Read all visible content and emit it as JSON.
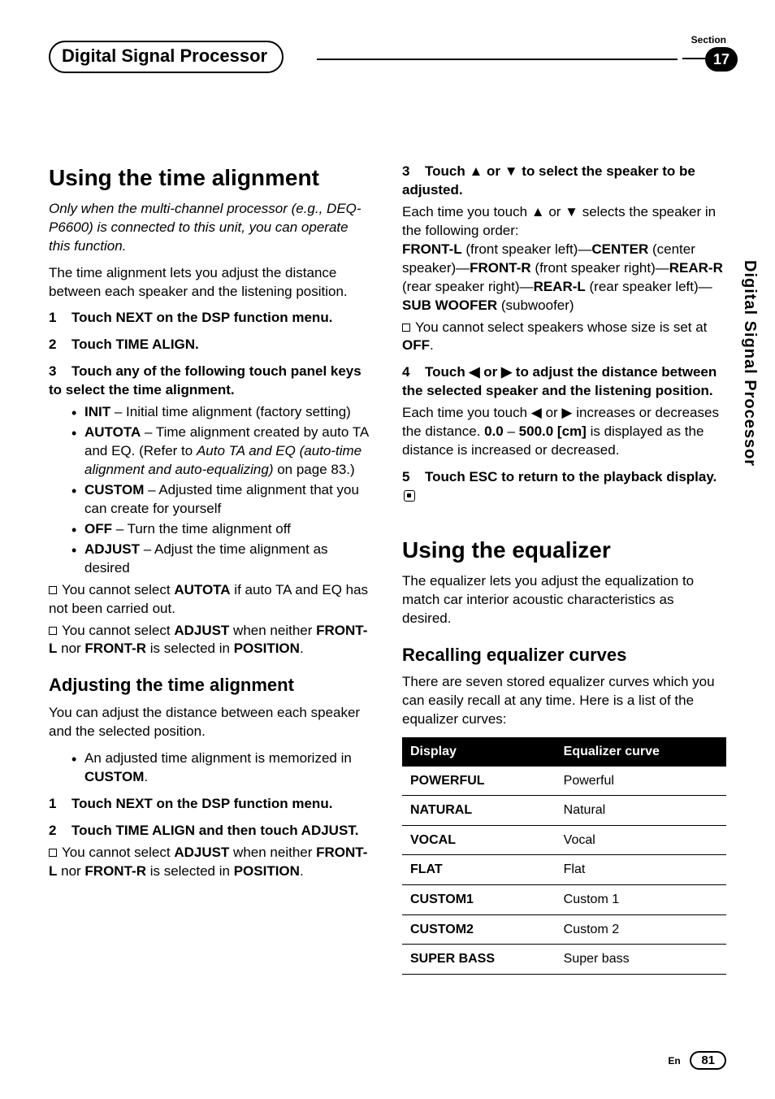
{
  "header": {
    "title": "Digital Signal Processor",
    "section_label": "Section",
    "section_number": "17"
  },
  "side_tab": "Digital Signal Processor",
  "left": {
    "h1": "Using the time alignment",
    "intro_italic": "Only when the multi-channel processor (e.g., DEQ-P6600) is connected to this unit, you can operate this function.",
    "intro_plain": "The time alignment lets you adjust the distance between each speaker and the listening position.",
    "step1": {
      "num": "1",
      "txt": "Touch NEXT on the DSP function menu."
    },
    "step2": {
      "num": "2",
      "txt": "Touch TIME ALIGN."
    },
    "step3": {
      "num": "3",
      "txt": "Touch any of the following touch panel keys to select the time alignment."
    },
    "items": {
      "init": {
        "key": "INIT",
        "desc": " – Initial time alignment (factory setting)"
      },
      "autota": {
        "key": "AUTOTA",
        "desc_a": " – Time alignment created by auto TA and EQ. (Refer to ",
        "desc_i": "Auto TA and EQ (auto-time alignment and auto-equalizing)",
        "desc_b": " on page 83.)"
      },
      "custom": {
        "key": "CUSTOM",
        "desc": " – Adjusted time alignment that you can create for yourself"
      },
      "off": {
        "key": "OFF",
        "desc": " – Turn the time alignment off"
      },
      "adjust": {
        "key": "ADJUST",
        "desc": " – Adjust the time alignment as desired"
      }
    },
    "note1_a": "You cannot select ",
    "note1_b": "AUTOTA",
    "note1_c": " if auto TA and EQ has not been carried out.",
    "note2_a": "You cannot select ",
    "note2_b": "ADJUST",
    "note2_c": " when neither ",
    "note2_d": "FRONT-L",
    "note2_e": " nor ",
    "note2_f": "FRONT-R",
    "note2_g": " is selected in ",
    "note2_h": "POSITION",
    "note2_i": ".",
    "h2": "Adjusting the time alignment",
    "adj_intro": "You can adjust the distance between each speaker and the selected position.",
    "adj_bullet_a": "An adjusted time alignment is memorized in ",
    "adj_bullet_b": "CUSTOM",
    "adj_bullet_c": ".",
    "adj_step1": {
      "num": "1",
      "txt": "Touch NEXT on the DSP function menu."
    },
    "adj_step2": {
      "num": "2",
      "txt": "Touch TIME ALIGN and then touch ADJUST."
    },
    "adj_note_a": "You cannot select ",
    "adj_note_b": "ADJUST",
    "adj_note_c": " when neither ",
    "adj_note_d": "FRONT-L",
    "adj_note_e": " nor ",
    "adj_note_f": "FRONT-R",
    "adj_note_g": " is selected in ",
    "adj_note_h": "POSITION",
    "adj_note_i": "."
  },
  "right": {
    "step3": {
      "num": "3",
      "txt_a": "Touch ",
      "up": "▲",
      "or1": " or ",
      "down": "▼",
      "txt_b": " to select the speaker to be adjusted."
    },
    "s3_body_a": "Each time you touch ",
    "s3_body_b": " or ",
    "s3_body_c": " selects the speaker in the following order:",
    "s3_seq_1a": "FRONT-L",
    "s3_seq_1b": " (front speaker left)—",
    "s3_seq_2a": "CENTER",
    "s3_seq_2b": " (center speaker)—",
    "s3_seq_3a": "FRONT-R",
    "s3_seq_3b": " (front speaker right)—",
    "s3_seq_4a": "REAR-R",
    "s3_seq_4b": " (rear speaker right)—",
    "s3_seq_5a": "REAR-L",
    "s3_seq_5b": " (rear speaker left)—",
    "s3_seq_6a": "SUB WOOFER",
    "s3_seq_6b": " (subwoofer)",
    "s3_note_a": "You cannot select speakers whose size is set at ",
    "s3_note_b": "OFF",
    "s3_note_c": ".",
    "step4": {
      "num": "4",
      "txt_a": "Touch ",
      "left": "◀",
      "or": " or ",
      "right_ar": "▶",
      "txt_b": " to adjust the distance between the selected speaker and the listening position."
    },
    "s4_body_a": "Each time you touch ",
    "s4_body_b": " or ",
    "s4_body_c": " increases or decreases the distance. ",
    "s4_range_a": "0.0",
    "s4_dash": " – ",
    "s4_range_b": "500.0 [cm]",
    "s4_body_d": " is displayed as the distance is increased or decreased.",
    "step5": {
      "num": "5",
      "txt": "Touch ESC to return to the playback display."
    },
    "h1": "Using the equalizer",
    "eq_intro": "The equalizer lets you adjust the equalization to match car interior acoustic characteristics as desired.",
    "h2": "Recalling equalizer curves",
    "recall_intro": "There are seven stored equalizer curves which you can easily recall at any time. Here is a list of the equalizer curves:"
  },
  "chart_data": {
    "type": "table",
    "columns": [
      "Display",
      "Equalizer curve"
    ],
    "rows": [
      [
        "POWERFUL",
        "Powerful"
      ],
      [
        "NATURAL",
        "Natural"
      ],
      [
        "VOCAL",
        "Vocal"
      ],
      [
        "FLAT",
        "Flat"
      ],
      [
        "CUSTOM1",
        "Custom 1"
      ],
      [
        "CUSTOM2",
        "Custom 2"
      ],
      [
        "SUPER BASS",
        "Super bass"
      ]
    ]
  },
  "footer": {
    "lang": "En",
    "page": "81"
  }
}
